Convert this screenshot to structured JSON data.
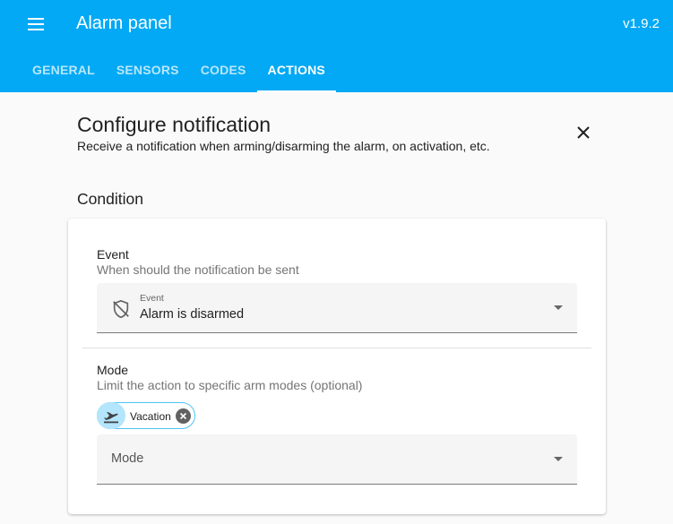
{
  "header": {
    "title": "Alarm panel",
    "version": "v1.9.2",
    "menu_icon": "hamburger-menu-icon"
  },
  "tabs": [
    {
      "label": "GENERAL",
      "active": false
    },
    {
      "label": "SENSORS",
      "active": false
    },
    {
      "label": "CODES",
      "active": false
    },
    {
      "label": "ACTIONS",
      "active": true
    }
  ],
  "dialog": {
    "title": "Configure notification",
    "subtitle": "Receive a notification when arming/disarming the alarm, on activation, etc."
  },
  "condition": {
    "section_title": "Condition",
    "event": {
      "label": "Event",
      "description": "When should the notification be sent",
      "select_label": "Event",
      "value": "Alarm is disarmed",
      "icon": "shield-off-icon"
    },
    "mode": {
      "label": "Mode",
      "description": "Limit the action to specific arm modes (optional)",
      "chips": [
        {
          "label": "Vacation",
          "icon": "airplane-takeoff-icon"
        }
      ],
      "placeholder": "Mode"
    }
  },
  "colors": {
    "primary": "#03a9f4",
    "chip_bg": "#b3e5fc",
    "chip_border": "#4fc3f7"
  }
}
